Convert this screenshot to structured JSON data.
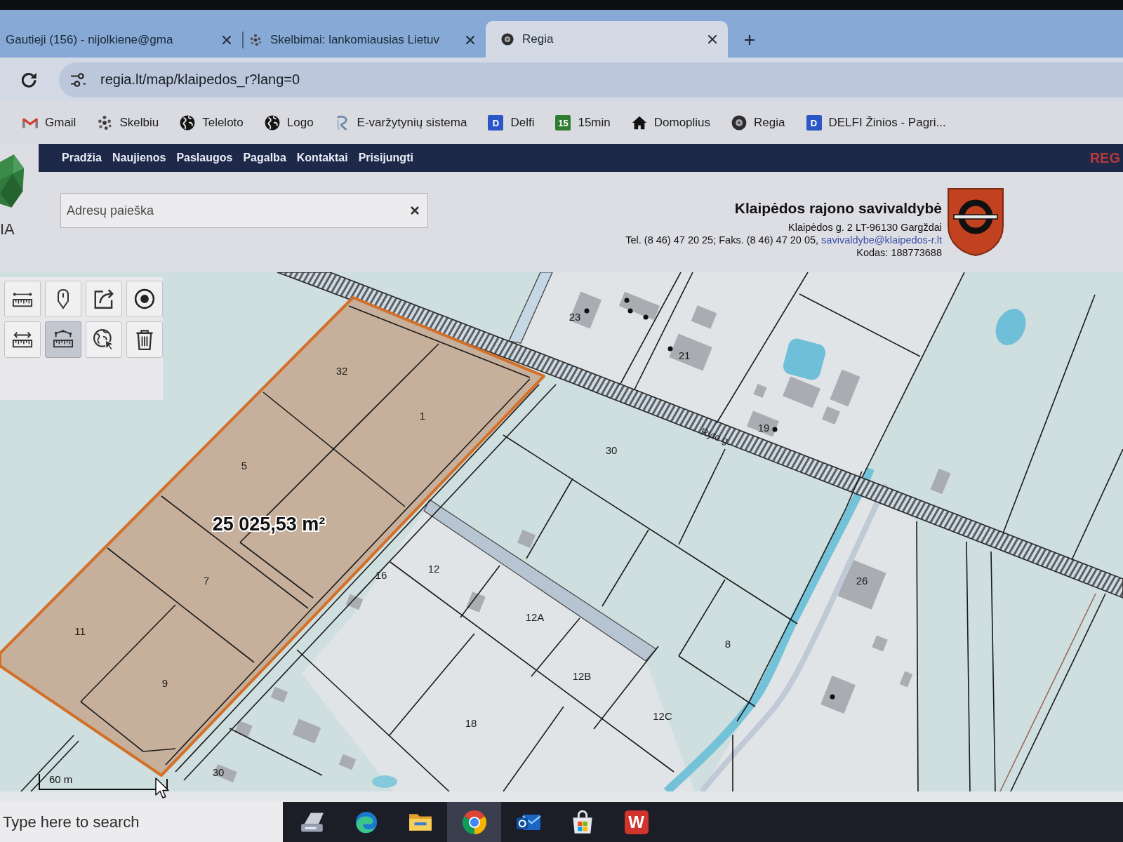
{
  "browser": {
    "tabs": [
      {
        "label": "Gautieji (156) - nijolkiene@gma",
        "kind": "plain",
        "selected": false
      },
      {
        "label": "Skelbimai: lankomiausias Lietuv",
        "kind": "dots",
        "selected": false
      },
      {
        "label": "Regia",
        "kind": "disc",
        "selected": true
      }
    ],
    "url": "regia.lt/map/klaipedos_r?lang=0",
    "bookmarks": [
      {
        "label": "Gmail",
        "kind": "mail"
      },
      {
        "label": "Skelbiu",
        "kind": "dots"
      },
      {
        "label": "Teleloto",
        "kind": "globe"
      },
      {
        "label": "Logo",
        "kind": "globe"
      },
      {
        "label": "E-varžytynių sistema",
        "kind": "swoosh"
      },
      {
        "label": "Delfi",
        "kind": "letter",
        "icon_text": "D",
        "color": "#2a56c6"
      },
      {
        "label": "15min",
        "kind": "letter",
        "icon_text": "15",
        "color": "#2e7d32"
      },
      {
        "label": "Domoplius",
        "kind": "house"
      },
      {
        "label": "Regia",
        "kind": "disc"
      },
      {
        "label": "DELFI Žinios - Pagri...",
        "kind": "letter",
        "icon_text": "D",
        "color": "#2a56c6"
      }
    ]
  },
  "site": {
    "logo_text": "IA",
    "nav": [
      "Pradžia",
      "Naujienos",
      "Paslaugos",
      "Pagalba",
      "Kontaktai",
      "Prisijungti"
    ],
    "corner_text": "REG",
    "search": {
      "placeholder": "Adresų paieška"
    },
    "municipality": {
      "name": "Klaipėdos rajono savivaldybė",
      "address": "Klaipėdos g. 2 LT-96130 Gargždai",
      "phones": "Tel. (8 46) 47 20 25; Faks. (8 46) 47 20 05,",
      "email": "savivaldybe@klaipedos-r.lt",
      "code": "Kodas: 188773688"
    }
  },
  "map": {
    "tools": [
      {
        "kind": "ruler",
        "selected": false
      },
      {
        "kind": "pin",
        "selected": false
      },
      {
        "kind": "export",
        "selected": false
      },
      {
        "kind": "target",
        "selected": false
      },
      {
        "kind": "distance",
        "selected": false
      },
      {
        "kind": "area",
        "selected": true
      },
      {
        "kind": "identify",
        "selected": false
      },
      {
        "kind": "delete",
        "selected": false
      }
    ],
    "parcel_numbers": [
      "23",
      "21",
      "32",
      "1",
      "19",
      "30",
      "5",
      "12",
      "16",
      "26",
      "7",
      "12A",
      "11",
      "8",
      "12B",
      "9",
      "12C",
      "18",
      "30"
    ],
    "area_label": "25 025,53 m²",
    "street_label": "Ryto g.",
    "scale_label": "60 m"
  },
  "taskbar": {
    "search": {
      "placeholder": "Type here to search"
    },
    "apps": [
      {
        "kind": "printer",
        "selected": false
      },
      {
        "kind": "swirl",
        "selected": false
      },
      {
        "kind": "folder",
        "selected": false
      },
      {
        "kind": "chrome",
        "selected": true
      },
      {
        "kind": "envelope",
        "selected": false
      },
      {
        "kind": "bag",
        "selected": false
      },
      {
        "kind": "tile",
        "icon_text": "W",
        "selected": false
      }
    ]
  }
}
